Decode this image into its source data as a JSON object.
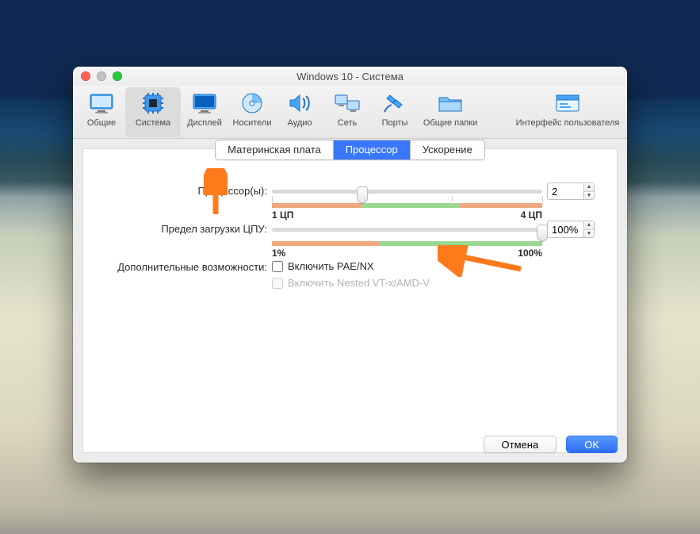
{
  "title": "Windows 10 - Система",
  "toolbar": {
    "general": "Общие",
    "system": "Система",
    "display": "Дисплей",
    "storage": "Носители",
    "audio": "Аудио",
    "network": "Сеть",
    "ports": "Порты",
    "shared": "Общие папки",
    "ui": "Интерфейс пользователя"
  },
  "tabs": {
    "motherboard": "Материнская плата",
    "processor": "Процессор",
    "accel": "Ускорение"
  },
  "labels": {
    "processors": "Процессор(ы):",
    "cap": "Предел загрузки ЦПУ:",
    "extra": "Дополнительные возможности:"
  },
  "scale": {
    "cpu_min": "1 ЦП",
    "cpu_max": "4 ЦП",
    "cap_min": "1%",
    "cap_max": "100%"
  },
  "values": {
    "processors": "2",
    "exec_cap": "100%"
  },
  "checks": {
    "pae": "Включить PAE/NX",
    "nested": "Включить Nested VT-x/AMD-V"
  },
  "buttons": {
    "cancel": "Отмена",
    "ok": "OK"
  }
}
